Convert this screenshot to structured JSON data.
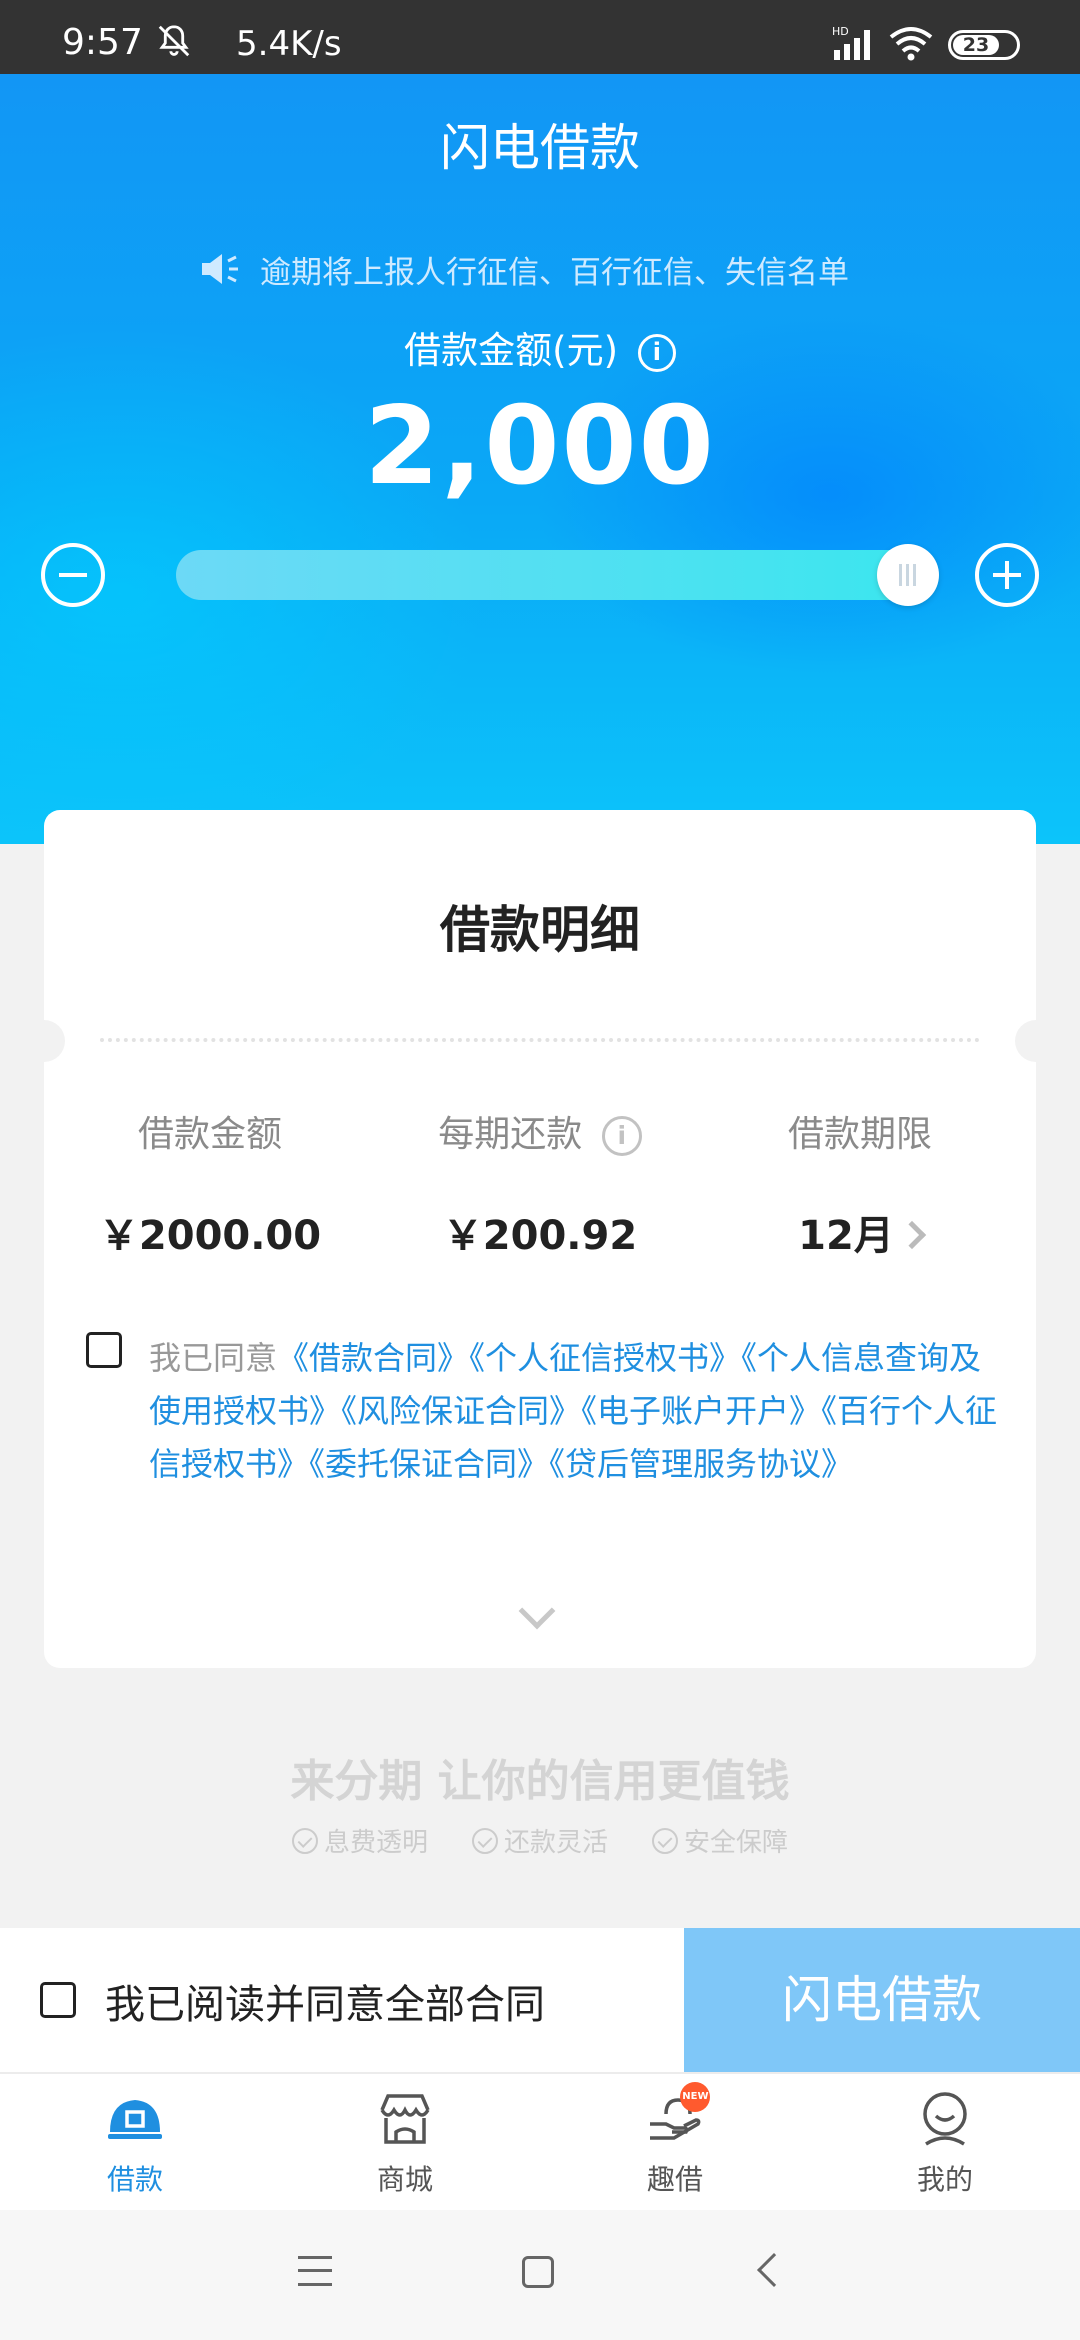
{
  "status_bar": {
    "time": "9:57",
    "speed": "5.4K/s",
    "network": "HD",
    "battery": "23"
  },
  "header": {
    "title": "闪电借款",
    "notice": "逾期将上报人行征信、百行征信、失信名单",
    "amount_label": "借款金额(元)",
    "amount_value": "2,000",
    "slider_fraction": 1.0
  },
  "detail_card": {
    "title": "借款明细",
    "columns": [
      {
        "label": "借款金额",
        "value": "￥2000.00"
      },
      {
        "label": "每期还款",
        "value": "￥200.92"
      },
      {
        "label": "借款期限",
        "value": "12月"
      }
    ],
    "agree_prefix": "我已同意",
    "agree_links": "《借款合同》《个人征信授权书》《个人信息查询及使用授权书》《风险保证合同》《电子账户开户》《百行个人征信授权书》《委托保证合同》《贷后管理服务协议》"
  },
  "slogan": {
    "title": "来分期 让你的信用更值钱",
    "features": [
      "息费透明",
      "还款灵活",
      "安全保障"
    ]
  },
  "action_bar": {
    "agree_label": "我已阅读并同意全部合同",
    "submit_label": "闪电借款"
  },
  "tabs": [
    {
      "label": "借款",
      "icon": "loan-icon",
      "active": true
    },
    {
      "label": "商城",
      "icon": "store-icon",
      "active": false
    },
    {
      "label": "趣借",
      "icon": "hand-coin-icon",
      "active": false,
      "badge": "NEW"
    },
    {
      "label": "我的",
      "icon": "profile-icon",
      "active": false
    }
  ],
  "colors": {
    "brand_blue": "#1296F5",
    "link_blue": "#1F8FE0",
    "submit_disabled": "#7FC7F8"
  }
}
